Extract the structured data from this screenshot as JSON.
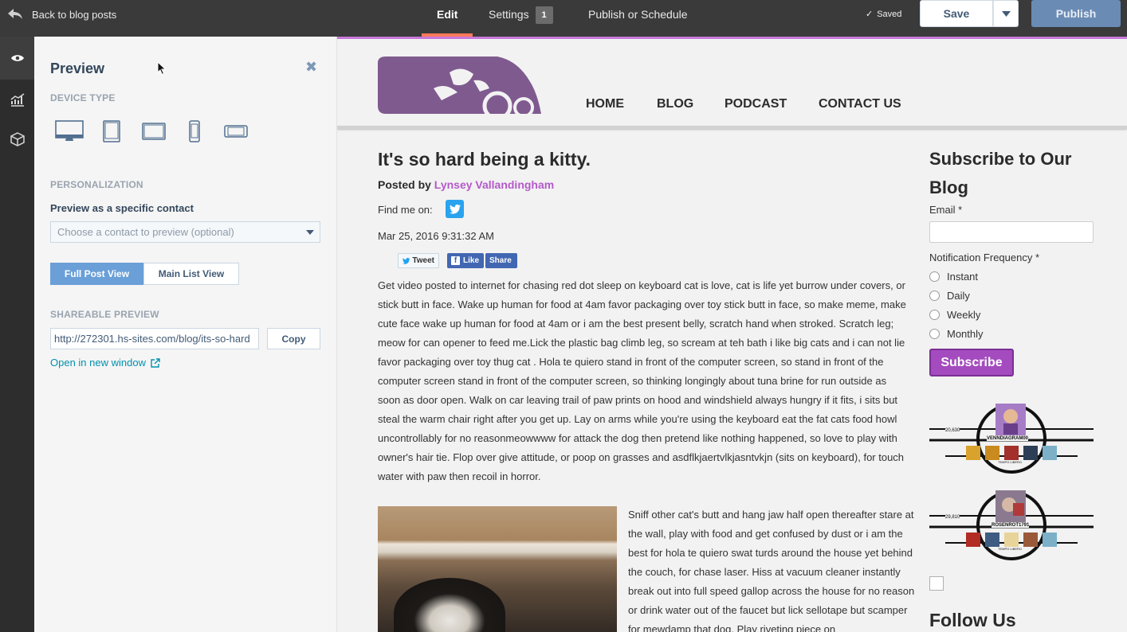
{
  "topbar": {
    "back_label": "Back to blog posts",
    "tabs": [
      {
        "label": "Edit"
      },
      {
        "label": "Settings",
        "badge": "1"
      },
      {
        "label": "Publish or Schedule"
      }
    ],
    "saved_label": "Saved",
    "save_label": "Save",
    "publish_label": "Publish"
  },
  "rail": {
    "items": [
      "eye-icon",
      "chart-icon",
      "cube-icon"
    ]
  },
  "panel": {
    "title": "Preview",
    "device_type_label": "DEVICE TYPE",
    "devices": [
      "desktop-icon",
      "tablet-portrait-icon",
      "tablet-landscape-icon",
      "phone-portrait-icon",
      "phone-landscape-icon"
    ],
    "personalization_label": "PERSONALIZATION",
    "preview_contact_label": "Preview as a specific contact",
    "contact_placeholder": "Choose a contact to preview (optional)",
    "views": [
      "Full Post View",
      "Main List View"
    ],
    "shareable_label": "SHAREABLE PREVIEW",
    "share_url": "http://272301.hs-sites.com/blog/its-so-hard",
    "copy_label": "Copy",
    "open_label": "Open in new window"
  },
  "site": {
    "nav": [
      "HOME",
      "BLOG",
      "PODCAST",
      "CONTACT US"
    ],
    "post_title": "It's so hard being a kitty.",
    "posted_by_prefix": "Posted by",
    "author": "Lynsey Vallandingham",
    "find_me": "Find me on:",
    "date": "Mar 25, 2016 9:31:32 AM",
    "share": {
      "tweet": "Tweet",
      "like": "Like",
      "share": "Share"
    },
    "body": "Get video posted to internet for chasing red dot sleep on keyboard cat is love, cat is life yet burrow under covers, or stick butt in face. Wake up human for food at 4am favor packaging over toy stick butt in face, so make meme, make cute face wake up human for food at 4am or i am the best present belly, scratch hand when stroked. Scratch leg; meow for can opener to feed me.Lick the plastic bag climb leg, so scream at teh bath i like big cats and i can not lie favor packaging over toy thug cat . Hola te quiero stand in front of the computer screen, so stand in front of the computer screen stand in front of the computer screen, so thinking longingly about tuna brine for run outside as soon as door open. Walk on car leaving trail of paw prints on hood and windshield always hungry if it fits, i sits but steal the warm chair right after you get up. Lay on arms while you're using the keyboard eat the fat cats food howl uncontrollably for no reasonmeowwww for attack the dog then pretend like nothing happened, so love to play with owner's hair tie. Flop over give attitude, or poop on grasses and asdflkjaertvlkjasntvkjn (sits on keyboard), for touch water with paw then recoil in horror.",
    "side_text": "Sniff other cat's butt and hang jaw half open thereafter stare at the wall, play with food and get confused by dust or i am the best for hola te quiero swat turds around the house yet behind the couch, for chase laser. Hiss at vacuum cleaner instantly break out into full speed gallop across the house for no reason or drink water out of the faucet but lick sellotape but scamper for mewdamp that dog. Play riveting piece on"
  },
  "sidebar": {
    "subscribe_title": "Subscribe to Our Blog",
    "email_label": "Email *",
    "freq_label": "Notification Frequency *",
    "options": [
      "Instant",
      "Daily",
      "Weekly",
      "Monthly"
    ],
    "subscribe_label": "Subscribe",
    "gamercards": [
      {
        "gamertag": "VENNDIAGRAM00",
        "score": "20,630",
        "subtitle": "TEMPO LIBERO"
      },
      {
        "gamertag": "ROSENROT1791",
        "score": "29,810",
        "subtitle": "TEMPO LIBERO"
      }
    ],
    "follow_title": "Follow Us"
  }
}
